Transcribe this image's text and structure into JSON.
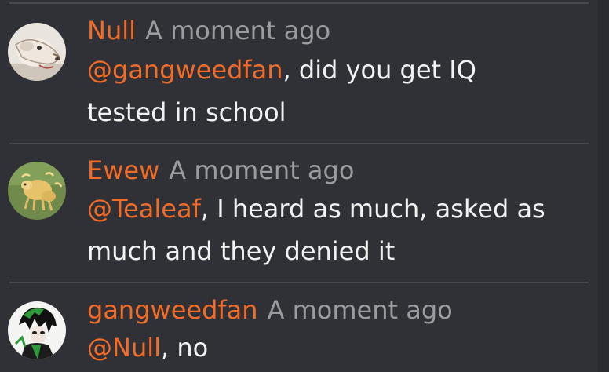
{
  "messages": [
    {
      "author": "Null",
      "time": "A moment ago",
      "mention": "@gangweedfan",
      "text_line1": ", did you get IQ",
      "text_line2": "tested in school"
    },
    {
      "author": "Ewew",
      "time": "A moment ago",
      "mention": "@Tealeaf",
      "text_line1": ", I heard as much, asked as",
      "text_line2": "much and they denied it"
    },
    {
      "author": "gangweedfan",
      "time": "A moment ago",
      "mention": "@Null",
      "text_line1": ", no"
    }
  ],
  "colors": {
    "background": "#2f3136",
    "accent": "#f26b27",
    "timestamp": "#9a9ca0",
    "text": "#f1f2f3"
  },
  "icons": {
    "avatar_null": "dog-avatar-icon",
    "avatar_ewew": "sheep-avatar-icon",
    "avatar_gangweedfan": "anime-character-avatar-icon"
  }
}
